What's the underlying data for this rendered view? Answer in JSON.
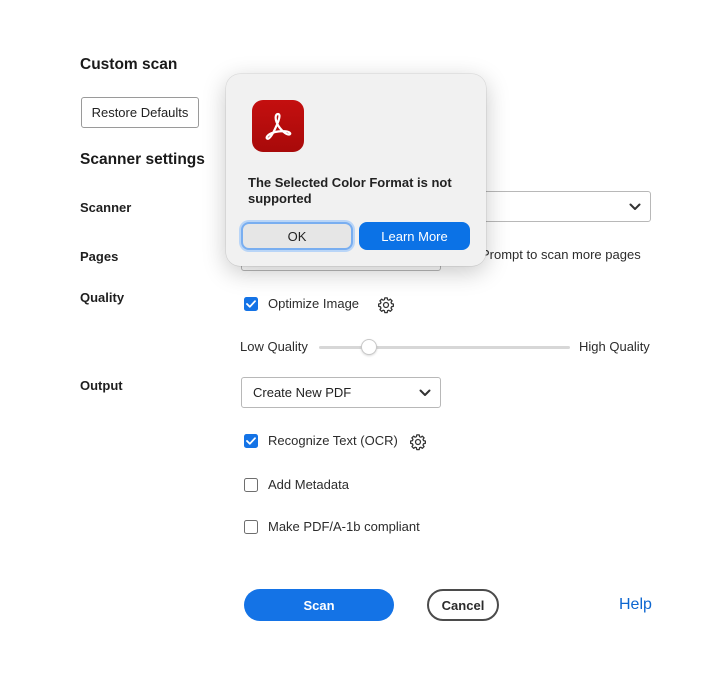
{
  "page": {
    "title": "Custom scan",
    "restore_defaults": "Restore Defaults",
    "section_title": "Scanner settings"
  },
  "scanner": {
    "label": "Scanner",
    "value": ""
  },
  "pages": {
    "label": "Pages",
    "prompt_text": "Prompt to scan more pages"
  },
  "quality": {
    "label": "Quality",
    "optimize_label": "Optimize Image",
    "optimize_checked": true,
    "low_label": "Low Quality",
    "high_label": "High Quality",
    "slider_level": 0.2
  },
  "output": {
    "label": "Output",
    "select_value": "Create New PDF",
    "ocr_label": "Recognize Text (OCR)",
    "ocr_checked": true,
    "metadata_label": "Add Metadata",
    "metadata_checked": false,
    "pdfa_label": "Make PDF/A-1b compliant",
    "pdfa_checked": false
  },
  "footer": {
    "scan": "Scan",
    "cancel": "Cancel",
    "help": "Help"
  },
  "dialog": {
    "message": "The Selected Color Format is not supported",
    "ok": "OK",
    "learn_more": "Learn More"
  },
  "colors": {
    "accent": "#1473e6",
    "link": "#0d66d0",
    "app_icon": "#b30b0b"
  },
  "icons": {
    "app": "acrobat-icon",
    "settings": "gear-icon",
    "dropdown": "chevron-down-icon",
    "check": "checkmark-icon"
  }
}
